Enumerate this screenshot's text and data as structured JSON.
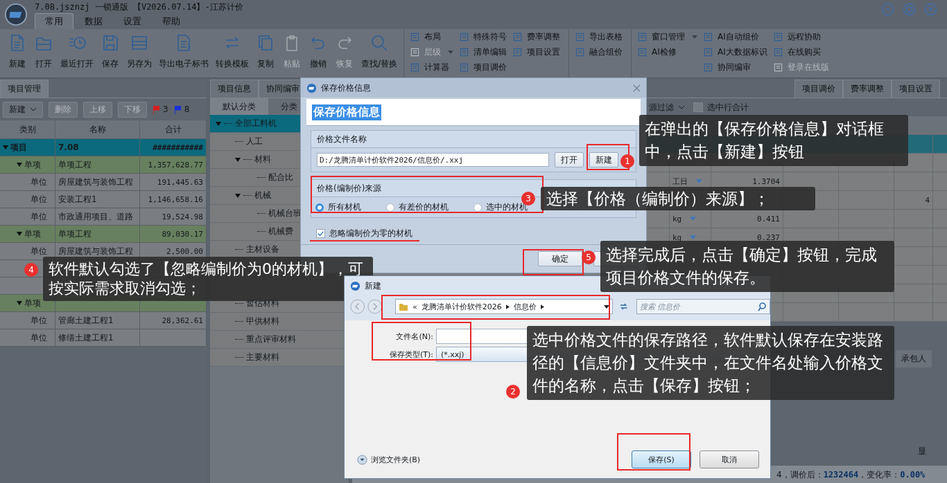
{
  "window": {
    "title": "7.08.jsznzj 一锁通版 【V2026.07.14】-江苏计价"
  },
  "menu_tabs": [
    {
      "label": "常用",
      "selected": true
    },
    {
      "label": "数据",
      "selected": false
    },
    {
      "label": "设置",
      "selected": false
    },
    {
      "label": "帮助",
      "selected": false
    }
  ],
  "ribbon_buttons": [
    {
      "label": "新建",
      "disabled": false
    },
    {
      "label": "打开",
      "disabled": false
    },
    {
      "label": "最近打开",
      "disabled": false
    },
    {
      "label": "保存",
      "disabled": false
    },
    {
      "label": "另存为",
      "disabled": false
    },
    {
      "label": "导出电子标书",
      "disabled": false
    },
    {
      "label": "转换模板",
      "disabled": false
    },
    {
      "label": "复制",
      "disabled": false
    },
    {
      "label": "粘贴",
      "disabled": true
    },
    {
      "label": "撤销",
      "disabled": false
    },
    {
      "label": "恢复",
      "disabled": true
    },
    {
      "label": "查找/替换",
      "disabled": false
    }
  ],
  "ribbon_groups": [
    {
      "columns": [
        [
          {
            "label": "布局",
            "disabled": false,
            "dropdown": false
          },
          {
            "label": "层级",
            "disabled": true,
            "dropdown": true
          },
          {
            "label": "计算器",
            "disabled": false,
            "dropdown": false
          }
        ],
        [
          {
            "label": "特殊符号",
            "disabled": false,
            "dropdown": false
          },
          {
            "label": "清单编辑",
            "disabled": false,
            "dropdown": false
          },
          {
            "label": "项目调价",
            "disabled": false,
            "dropdown": false
          }
        ],
        [
          {
            "label": "费率调整",
            "disabled": false,
            "dropdown": false
          },
          {
            "label": "项目设置",
            "disabled": false,
            "dropdown": false
          }
        ]
      ]
    },
    {
      "columns": [
        [
          {
            "label": "导出表格",
            "disabled": false,
            "dropdown": false
          },
          {
            "label": "融合组价",
            "disabled": false,
            "dropdown": false
          }
        ]
      ]
    },
    {
      "columns": [
        [
          {
            "label": "窗口管理",
            "disabled": false,
            "dropdown": true
          },
          {
            "label": "AI检修",
            "disabled": false,
            "dropdown": false
          }
        ],
        [
          {
            "label": "AI自动组价",
            "disabled": false,
            "dropdown": false
          },
          {
            "label": "AI大数据标识",
            "disabled": false,
            "dropdown": false
          },
          {
            "label": "协同编审",
            "disabled": false,
            "dropdown": false
          }
        ],
        [
          {
            "label": "远程协助",
            "disabled": false,
            "dropdown": false
          },
          {
            "label": "在线购买",
            "disabled": false,
            "dropdown": false
          },
          {
            "label": "登录在线版",
            "disabled": true,
            "dropdown": false
          }
        ]
      ]
    }
  ],
  "project_panel": {
    "tab": "项目管理",
    "toolbar": [
      {
        "label": "新建",
        "disabled": false,
        "dropdown": true
      },
      {
        "label": "删除",
        "disabled": true,
        "dropdown": false
      },
      {
        "label": "上移",
        "disabled": true,
        "dropdown": false
      },
      {
        "label": "下移",
        "disabled": true,
        "dropdown": false
      }
    ],
    "flags": [
      {
        "color": "#d81e1e",
        "count": "3"
      },
      {
        "color": "#1b2fd6",
        "count": "8"
      }
    ],
    "columns": [
      "类别",
      "名称",
      "合计"
    ],
    "tree": [
      {
        "kind": "project",
        "type": "项目",
        "name": "7.08",
        "total": "###########",
        "selected": true,
        "expanded": true,
        "children": [
          {
            "kind": "item",
            "type": "单项",
            "name": "单项工程",
            "total": "1,357,628.77",
            "selected": false,
            "expanded": true,
            "children": [
              {
                "kind": "unit",
                "type": "单位",
                "name": "房屋建筑与装饰工程",
                "total": "191,445.63",
                "selected": false
              },
              {
                "kind": "unit",
                "type": "单位",
                "name": "安装工程1",
                "total": "1,146,658.16",
                "selected": false
              },
              {
                "kind": "unit",
                "type": "单位",
                "name": "市政通用项目、道路",
                "total": "19,524.98",
                "selected": false
              }
            ]
          },
          {
            "kind": "item",
            "type": "单项",
            "name": "单项工程",
            "total": "89,030.17",
            "selected": false,
            "expanded": true,
            "children": [
              {
                "kind": "unit",
                "type": "单位",
                "name": "房屋建筑与装饰工程",
                "total": "2,500.00",
                "selected": false
              },
              {
                "kind": "unit"
              },
              {
                "kind": "unit"
              }
            ]
          },
          {
            "kind": "item",
            "type": "单项",
            "selected": false,
            "expanded": true,
            "children": [
              {
                "kind": "unit",
                "type": "单位",
                "name": "管廊土建工程1",
                "total": "28,362.61",
                "selected": false
              },
              {
                "kind": "unit",
                "type": "单位",
                "name": "修缮土建工程1",
                "selected": false
              }
            ]
          }
        ]
      }
    ]
  },
  "material_panel": {
    "tabs": [
      "项目信息",
      "协同编审"
    ],
    "sub_tabs": [
      {
        "label": "默认分类",
        "selected": true
      },
      {
        "label": "分类",
        "selected": false
      }
    ],
    "tree": [
      {
        "kind": "entry",
        "label": "全部工料机",
        "selected": true,
        "expanded": true,
        "children": [
          {
            "kind": "entry",
            "label": "人工",
            "selected": false
          },
          {
            "kind": "entry",
            "label": "材料",
            "selected": false,
            "expanded": true,
            "children": [
              {
                "kind": "entry",
                "label": "配合比",
                "selected": false
              }
            ]
          },
          {
            "kind": "entry",
            "label": "机械",
            "selected": false,
            "expanded": true,
            "children": [
              {
                "kind": "entry",
                "label": "机械台班",
                "selected": false
              },
              {
                "kind": "entry",
                "label": "机械费",
                "selected": false
              }
            ]
          },
          {
            "kind": "entry",
            "label": "主材设备",
            "selected": false
          },
          {
            "kind": "covered"
          },
          {
            "kind": "covered"
          },
          {
            "kind": "entry",
            "label": "暂估材料",
            "selected": false
          },
          {
            "kind": "entry",
            "label": "甲供材料",
            "selected": false
          },
          {
            "kind": "entry",
            "label": "重点评审材料",
            "selected": false
          },
          {
            "kind": "entry",
            "label": "主要材料",
            "selected": false
          }
        ]
      }
    ]
  },
  "detail_panel": {
    "tabs": [
      "项目调价",
      "费率调整",
      "项目设置"
    ],
    "filter": {
      "label": "源过滤"
    },
    "row_total": {
      "label": "选中行合计",
      "checked": false
    },
    "rows": [
      {
        "selected": true
      },
      {
        "selected": false
      },
      {
        "selected": false,
        "unit": "工日",
        "quantity": "1.3704"
      },
      {
        "selected": false,
        "column_7": "4"
      },
      {
        "selected": false,
        "unit": "kg",
        "quantity": "0.411"
      },
      {
        "selected": false,
        "unit": "kg",
        "quantity": "0.237"
      },
      {
        "selected": false
      },
      {
        "selected": false
      },
      {
        "selected": false
      },
      {
        "selected": false
      }
    ],
    "contractor_header": "承包人",
    "show_header": "显",
    "status": {
      "prefix": "4，调价后：",
      "after": "1232464",
      "rate_label": "，变化率：",
      "rate": "0.00%"
    }
  },
  "save_price_dialog": {
    "title": "保存价格信息",
    "heading": "保存价格信息",
    "file_group": {
      "label": "价格文件名称",
      "path": "D:/龙腾清单计价软件2026/信息价/.xxj",
      "buttons": [
        "打开",
        "新建"
      ]
    },
    "source_group": {
      "label": "价格(编制价)来源",
      "options": [
        {
          "label": "所有材机",
          "selected": true
        },
        {
          "label": "有差价的材机",
          "selected": false
        },
        {
          "label": "选中的材机",
          "selected": false
        }
      ]
    },
    "ignore_zero": {
      "label": "忽略编制价为零的材机",
      "checked": true
    },
    "ok_button": "确定"
  },
  "file_dialog": {
    "title": "新建",
    "path_prefix": "«",
    "path": [
      "龙腾清单计价软件2026",
      "信息价"
    ],
    "search": {
      "placeholder": "搜索 信息价"
    },
    "fields": [
      {
        "kind": "text",
        "label": "文件名(N):"
      },
      {
        "kind": "select",
        "label": "保存类型(T):",
        "value": "(*.xxj)"
      }
    ],
    "browse": "浏览文件夹(B)",
    "buttons": [
      {
        "label": "保存(S)",
        "primary": true
      },
      {
        "label": "取消",
        "primary": false
      }
    ]
  },
  "callouts": [
    {
      "number": "1",
      "text": "在弹出的【保存价格信息】对话框中，点击【新建】按钮"
    },
    {
      "number": "3",
      "text": "选择【价格（编制价）来源】；"
    },
    {
      "number": "5",
      "text": "选择完成后，点击【确定】按钮，完成项目价格文件的保存。"
    },
    {
      "number": "4",
      "text": "软件默认勾选了【忽略编制价为0的材机】，可按实际需求取消勾选；"
    },
    {
      "number": "2",
      "text": "选中价格文件的保存路径，软件默认保存在安装路径的【信息价】文件夹中，在文件名处输入价格文件的名称，点击【保存】按钮；"
    }
  ]
}
